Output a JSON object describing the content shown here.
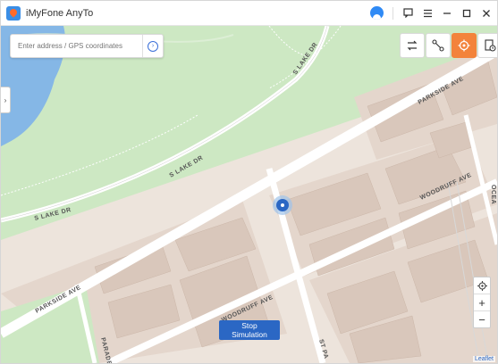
{
  "app": {
    "title": "iMyFone AnyTo"
  },
  "search": {
    "placeholder": "Enter address / GPS coordinates",
    "value": ""
  },
  "map": {
    "streets": {
      "parkside_ave": "PARKSIDE AVE",
      "s_lake_dr": "S LAKE DR",
      "woodruff_ave": "WOODRUFF AVE",
      "st_paul_pl": "ST PA",
      "parade": "PARADE",
      "ocean": "OCEA"
    },
    "attribution": "Leaflet"
  },
  "actions": {
    "stop_simulation": "Stop Simulation"
  },
  "colors": {
    "accent": "#f3833b",
    "button": "#2b67c4",
    "park": "#cde8c3",
    "water": "#7fb3e6",
    "block": "#e6d9d0"
  }
}
